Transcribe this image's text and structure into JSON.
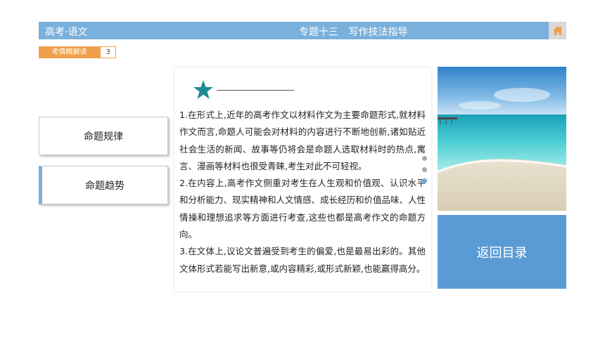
{
  "header": {
    "subject": "高考·语文",
    "topic": "专题十三 写作技法指导",
    "home_icon": "home-icon"
  },
  "section": {
    "tab_label": "考情精解读",
    "number": "3"
  },
  "nav": {
    "items": [
      {
        "label": "命题规律",
        "active": false
      },
      {
        "label": "命题趋势",
        "active": true
      }
    ]
  },
  "content": {
    "paragraphs": [
      "1.在形式上,近年的高考作文以材料作文为主要命题形式,就材料作文而言,命题人可能会对材料的内容进行不断地创新,诸如贴近社会生活的新闻、故事等仍将会是命题人选取材料时的热点,寓言、漫画等材料也很受青睐,考生对此不可轻视。",
      "2.在内容上,高考作文侧重对考生在人生观和价值观、认识水平和分析能力、现实精神和人文情感、成长经历和价值品味、人性情操和理想追求等方面进行考查,这些也都是高考作文的命题方向。",
      "3.在文体上,议论文普遍受到考生的偏爱,也是最易出彩的。其他文体形式若能写出新意,或内容精彩,或形式新颖,也能赢得高分。"
    ]
  },
  "pagination": {
    "count": 3,
    "active_index": 2
  },
  "return_button": {
    "label": "返回目录"
  },
  "colors": {
    "header_bg": "#7ab0dc",
    "accent_orange": "#f0a04b",
    "star_teal": "#1f8a96",
    "return_bg": "#5b9bd5"
  }
}
